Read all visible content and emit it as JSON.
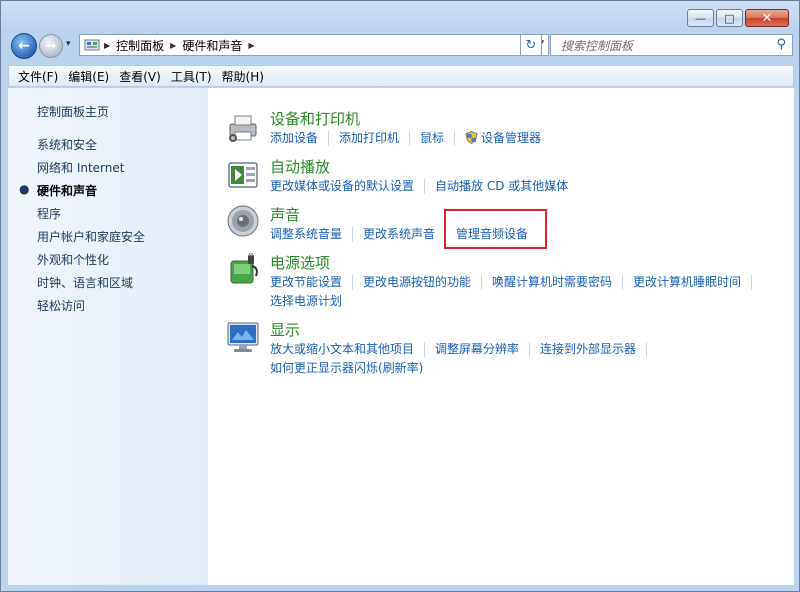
{
  "window": {
    "minimize_glyph": "—",
    "maximize_glyph": "□",
    "close_glyph": "✕"
  },
  "nav": {
    "back_glyph": "←",
    "forward_glyph": "→",
    "history_glyph": "▾",
    "breadcrumb": [
      "控制面板",
      "硬件和声音"
    ],
    "refresh_glyph": "↻",
    "search_placeholder": "搜索控制面板",
    "search_value": ""
  },
  "menu": [
    "文件(F)",
    "编辑(E)",
    "查看(V)",
    "工具(T)",
    "帮助(H)"
  ],
  "sidebar": {
    "items": [
      {
        "label": "控制面板主页",
        "active": false
      },
      {
        "label": "系统和安全",
        "active": false
      },
      {
        "label": "网络和 Internet",
        "active": false
      },
      {
        "label": "硬件和声音",
        "active": true
      },
      {
        "label": "程序",
        "active": false
      },
      {
        "label": "用户帐户和家庭安全",
        "active": false
      },
      {
        "label": "外观和个性化",
        "active": false
      },
      {
        "label": "时钟、语言和区域",
        "active": false
      },
      {
        "label": "轻松访问",
        "active": false
      }
    ]
  },
  "categories": [
    {
      "title": "设备和打印机",
      "icon": "printer-icon",
      "links": [
        "添加设备",
        "添加打印机",
        "鼠标",
        "设备管理器"
      ]
    },
    {
      "title": "自动播放",
      "icon": "autoplay-icon",
      "links": [
        "更改媒体或设备的默认设置",
        "自动播放 CD 或其他媒体"
      ]
    },
    {
      "title": "声音",
      "icon": "speaker-icon",
      "links": [
        "调整系统音量",
        "更改系统声音",
        "管理音频设备"
      ]
    },
    {
      "title": "电源选项",
      "icon": "power-icon",
      "links": [
        "更改节能设置",
        "更改电源按钮的功能",
        "唤醒计算机时需要密码",
        "更改计算机睡眠时间",
        "选择电源计划"
      ]
    },
    {
      "title": "显示",
      "icon": "display-icon",
      "links": [
        "放大或缩小文本和其他项目",
        "调整屏幕分辨率",
        "连接到外部显示器",
        "如何更正显示器闪烁(刷新率)"
      ]
    }
  ],
  "colors": {
    "category_title": "#2a8a2a",
    "link": "#1a5fb4",
    "highlight_box": "#e0242c"
  }
}
